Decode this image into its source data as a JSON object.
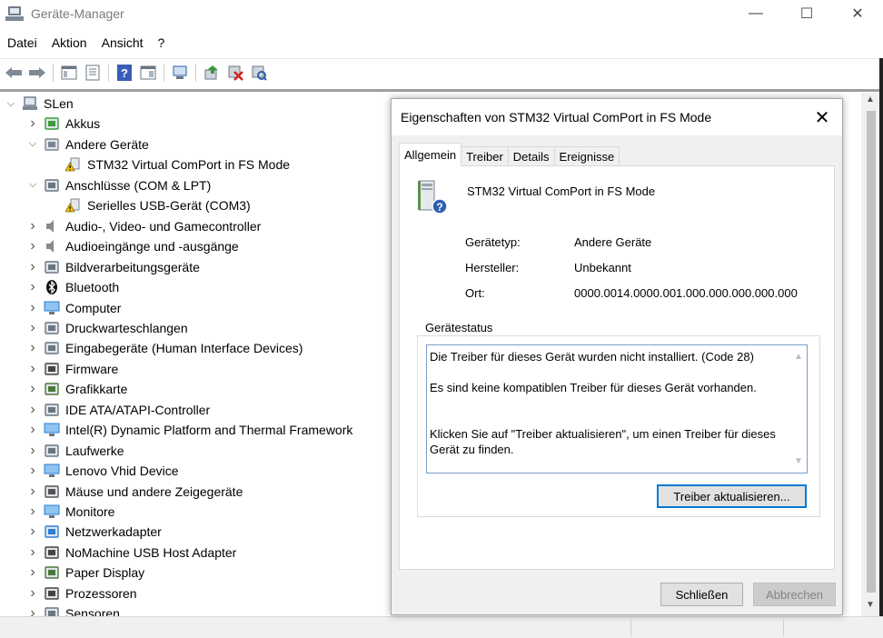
{
  "window": {
    "title": "Geräte-Manager",
    "controls": {
      "minimize": "—",
      "maximize": "☐",
      "close": "✕"
    }
  },
  "menu": [
    "Datei",
    "Aktion",
    "Ansicht",
    "?"
  ],
  "toolbar": {
    "icons": [
      "back-icon",
      "forward-icon",
      "show-hide-tree-icon",
      "properties-icon",
      "help-icon",
      "action-view-icon",
      "display-devices-icon",
      "update-driver-icon",
      "uninstall-device-icon",
      "scan-hardware-icon"
    ]
  },
  "tree": {
    "root": "SLen",
    "items": [
      {
        "label": "Akkus",
        "level": 1,
        "expanded": false,
        "icon": "battery-icon"
      },
      {
        "label": "Andere Geräte",
        "level": 1,
        "expanded": true,
        "icon": "unknown-device-icon"
      },
      {
        "label": "STM32 Virtual ComPort in FS Mode",
        "level": 2,
        "icon": "warning-device-icon"
      },
      {
        "label": "Anschlüsse (COM & LPT)",
        "level": 1,
        "expanded": true,
        "icon": "port-icon"
      },
      {
        "label": "Serielles USB-Gerät (COM3)",
        "level": 2,
        "icon": "warning-device-icon"
      },
      {
        "label": "Audio-, Video- und Gamecontroller",
        "level": 1,
        "expanded": false,
        "icon": "speaker-icon"
      },
      {
        "label": "Audioeingänge und -ausgänge",
        "level": 1,
        "expanded": false,
        "icon": "speaker-icon"
      },
      {
        "label": "Bildverarbeitungsgeräte",
        "level": 1,
        "expanded": false,
        "icon": "camera-icon"
      },
      {
        "label": "Bluetooth",
        "level": 1,
        "expanded": false,
        "icon": "bluetooth-icon"
      },
      {
        "label": "Computer",
        "level": 1,
        "expanded": false,
        "icon": "monitor-icon"
      },
      {
        "label": "Druckwarteschlangen",
        "level": 1,
        "expanded": false,
        "icon": "printer-icon"
      },
      {
        "label": "Eingabegeräte (Human Interface Devices)",
        "level": 1,
        "expanded": false,
        "icon": "hid-icon"
      },
      {
        "label": "Firmware",
        "level": 1,
        "expanded": false,
        "icon": "firmware-icon"
      },
      {
        "label": "Grafikkarte",
        "level": 1,
        "expanded": false,
        "icon": "graphics-card-icon"
      },
      {
        "label": "IDE ATA/ATAPI-Controller",
        "level": 1,
        "expanded": false,
        "icon": "disk-controller-icon"
      },
      {
        "label": "Intel(R) Dynamic Platform and Thermal Framework",
        "level": 1,
        "expanded": false,
        "icon": "monitor-icon"
      },
      {
        "label": "Laufwerke",
        "level": 1,
        "expanded": false,
        "icon": "drive-icon"
      },
      {
        "label": "Lenovo Vhid Device",
        "level": 1,
        "expanded": false,
        "icon": "monitor-icon"
      },
      {
        "label": "Mäuse und andere Zeigegeräte",
        "level": 1,
        "expanded": false,
        "icon": "mouse-icon"
      },
      {
        "label": "Monitore",
        "level": 1,
        "expanded": false,
        "icon": "monitor-icon"
      },
      {
        "label": "Netzwerkadapter",
        "level": 1,
        "expanded": false,
        "icon": "network-icon"
      },
      {
        "label": "NoMachine USB Host Adapter",
        "level": 1,
        "expanded": false,
        "icon": "usb-icon"
      },
      {
        "label": "Paper Display",
        "level": 1,
        "expanded": false,
        "icon": "graphics-card-icon"
      },
      {
        "label": "Prozessoren",
        "level": 1,
        "expanded": false,
        "icon": "processor-icon"
      },
      {
        "label": "Sensoren",
        "level": 1,
        "expanded": false,
        "icon": "sensor-icon"
      }
    ]
  },
  "dialog": {
    "title": "Eigenschaften von STM32 Virtual ComPort in FS Mode",
    "close": "✕",
    "tabs": [
      "Allgemein",
      "Treiber",
      "Details",
      "Ereignisse"
    ],
    "active_tab": "Allgemein",
    "device_name": "STM32 Virtual ComPort in FS Mode",
    "properties": [
      {
        "label": "Gerätetyp:",
        "value": "Andere Geräte"
      },
      {
        "label": "Hersteller:",
        "value": "Unbekannt"
      },
      {
        "label": "Ort:",
        "value": "0000.0014.0000.001.000.000.000.000.000"
      }
    ],
    "status_group_label": "Gerätestatus",
    "status_lines": [
      "Die Treiber für dieses Gerät wurden nicht installiert. (Code 28)",
      "Es sind keine kompatiblen Treiber für dieses Gerät vorhanden.",
      "Klicken Sie auf \"Treiber aktualisieren\", um einen Treiber für dieses Gerät zu finden."
    ],
    "update_driver_button": "Treiber aktualisieren...",
    "close_button": "Schließen",
    "cancel_button": "Abbrechen"
  }
}
